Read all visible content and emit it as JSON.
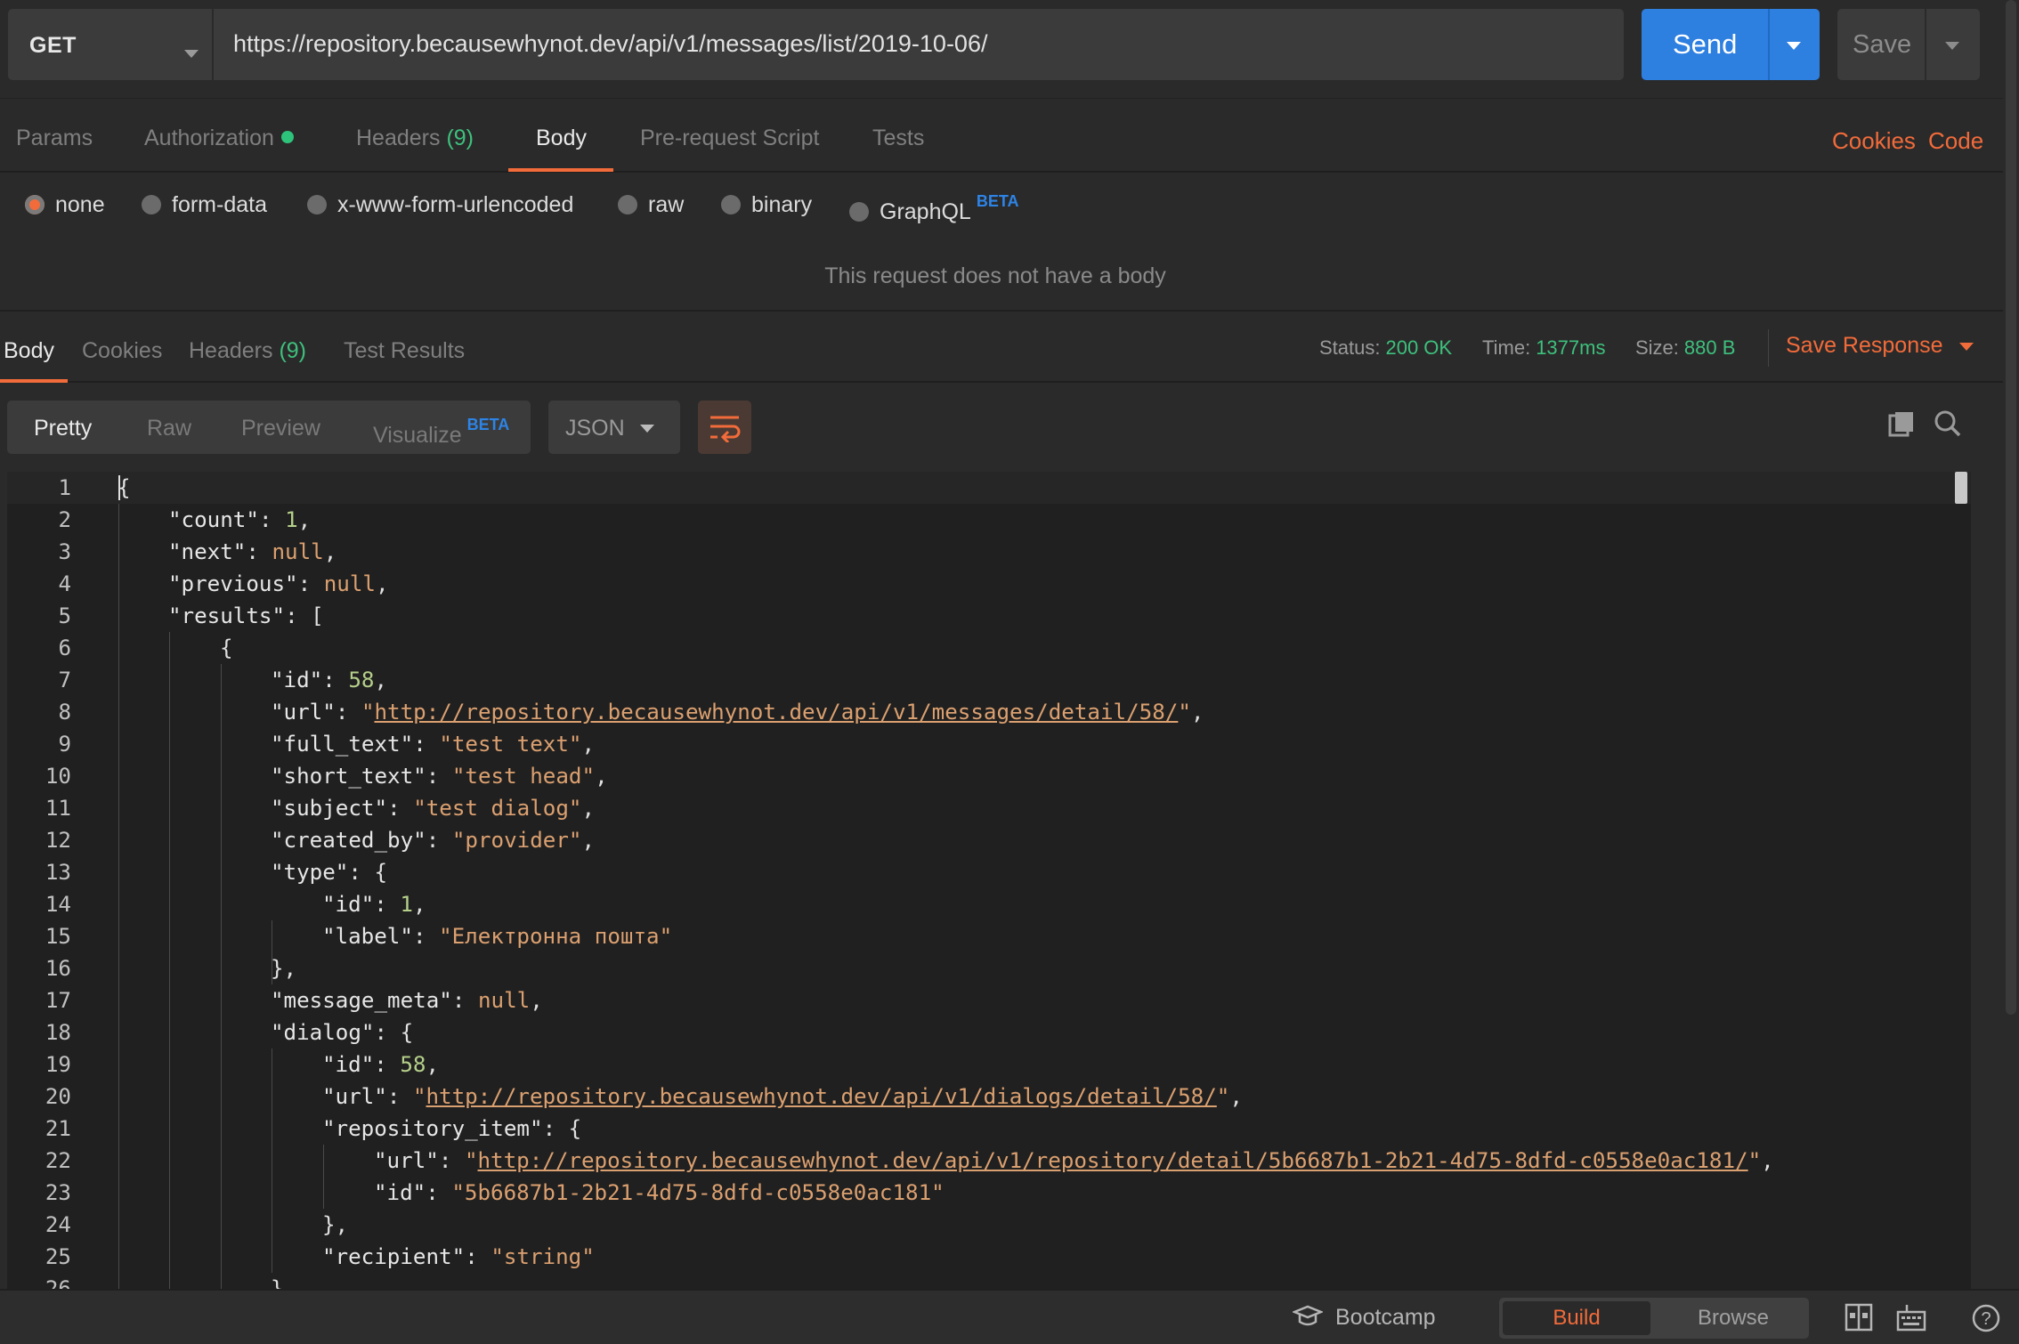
{
  "request": {
    "method": "GET",
    "url": "https://repository.becausewhynot.dev/api/v1/messages/list/2019-10-06/",
    "send_label": "Send",
    "save_label": "Save"
  },
  "request_tabs": {
    "params": "Params",
    "authorization": "Authorization",
    "headers": "Headers",
    "headers_count": "(9)",
    "body": "Body",
    "prerequest": "Pre-request Script",
    "tests": "Tests",
    "cookies": "Cookies",
    "code": "Code"
  },
  "body_types": {
    "none": "none",
    "form_data": "form-data",
    "urlencoded": "x-www-form-urlencoded",
    "raw": "raw",
    "binary": "binary",
    "graphql": "GraphQL",
    "graphql_badge": "BETA",
    "selected": "none"
  },
  "no_body_message": "This request does not have a body",
  "response_tabs": {
    "body": "Body",
    "cookies": "Cookies",
    "headers": "Headers",
    "headers_count": "(9)",
    "test_results": "Test Results"
  },
  "response_meta": {
    "status_label": "Status:",
    "status_value": "200 OK",
    "time_label": "Time:",
    "time_value": "1377ms",
    "size_label": "Size:",
    "size_value": "880 B",
    "save_response": "Save Response"
  },
  "view_modes": {
    "pretty": "Pretty",
    "raw": "Raw",
    "preview": "Preview",
    "visualize": "Visualize",
    "visualize_badge": "BETA",
    "format": "JSON"
  },
  "code_lines": [
    "{",
    "\"count\": 1,",
    "\"next\": null,",
    "\"previous\": null,",
    "\"results\": [",
    "{",
    "\"id\": 58,",
    "\"url\": \"http://repository.becausewhynot.dev/api/v1/messages/detail/58/\",",
    "\"full_text\": \"test text\",",
    "\"short_text\": \"test head\",",
    "\"subject\": \"test dialog\",",
    "\"created_by\": \"provider\",",
    "\"type\": {",
    "\"id\": 1,",
    "\"label\": \"Електронна пошта\"",
    "},",
    "\"message_meta\": null,",
    "\"dialog\": {",
    "\"id\": 58,",
    "\"url\": \"http://repository.becausewhynot.dev/api/v1/dialogs/detail/58/\",",
    "\"repository_item\": {",
    "\"url\": \"http://repository.becausewhynot.dev/api/v1/repository/detail/5b6687b1-2b21-4d75-8dfd-c0558e0ac181/\",",
    "\"id\": \"5b6687b1-2b21-4d75-8dfd-c0558e0ac181\"",
    "},",
    "\"recipient\": \"string\"",
    "}"
  ],
  "statusbar": {
    "bootcamp": "Bootcamp",
    "build": "Build",
    "browse": "Browse"
  },
  "colors": {
    "accent": "#f26b3a",
    "primary": "#2d7fe0",
    "success": "#3ec07d",
    "beta": "#2d84e6"
  }
}
